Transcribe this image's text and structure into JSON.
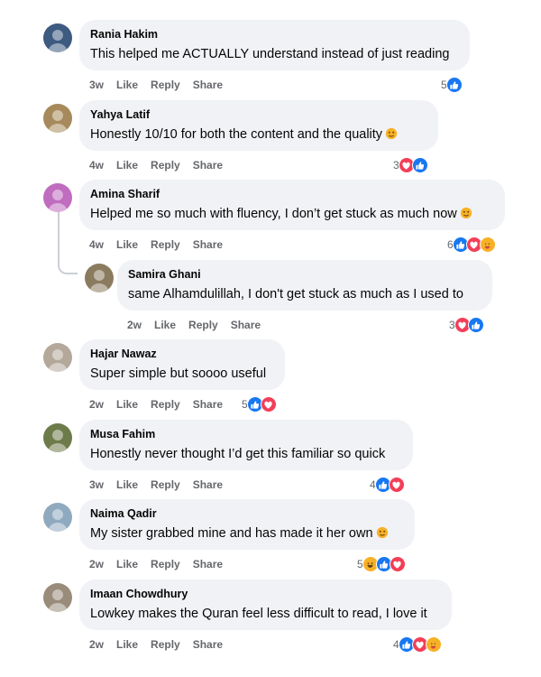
{
  "comments": [
    {
      "name": "Rania Hakim",
      "text": "This helped me ACTUALLY understand instead of just reading",
      "time": "3w",
      "like": "Like",
      "reply": "Reply",
      "share": "Share",
      "count": "5",
      "reactions": [
        "like"
      ],
      "avatar_color": "#3d5a80"
    },
    {
      "name": "Yahya Latif",
      "text": "Honestly 10/10 for both the content and the quality",
      "time": "4w",
      "like": "Like",
      "reply": "Reply",
      "share": "Share",
      "count": "3",
      "reactions": [
        "love",
        "like"
      ],
      "inline_emoji": "raising-hands-emoji",
      "avatar_color": "#a68a5b"
    },
    {
      "name": "Amina Sharif",
      "text": "Helped me so much with fluency, I don’t get stuck as much now",
      "time": "4w",
      "like": "Like",
      "reply": "Reply",
      "share": "Share",
      "count": "6",
      "reactions": [
        "like",
        "love",
        "care"
      ],
      "inline_emoji": "pleading-face-emoji",
      "avatar_color": "#c06cbf"
    },
    {
      "name": "Samira Ghani",
      "text": "same Alhamdulillah,  I don't get stuck as much as I used to",
      "time": "2w",
      "like": "Like",
      "reply": "Reply",
      "share": "Share",
      "count": "3",
      "reactions": [
        "love",
        "like"
      ],
      "avatar_color": "#8b7b5e",
      "is_reply": true
    },
    {
      "name": "Hajar Nawaz",
      "text": "Super simple but soooo useful",
      "time": "2w",
      "like": "Like",
      "reply": "Reply",
      "share": "Share",
      "count": "5",
      "reactions": [
        "like",
        "love"
      ],
      "avatar_color": "#b3a89a"
    },
    {
      "name": "Musa Fahim",
      "text": "Honestly never thought I’d get this familiar so quick",
      "time": "3w",
      "like": "Like",
      "reply": "Reply",
      "share": "Share",
      "count": "4",
      "reactions": [
        "like",
        "love"
      ],
      "avatar_color": "#6d7a4a"
    },
    {
      "name": "Naima Qadir",
      "text": "My sister grabbed mine and has made it her own",
      "time": "2w",
      "like": "Like",
      "reply": "Reply",
      "share": "Share",
      "count": "5",
      "reactions": [
        "haha",
        "like",
        "love"
      ],
      "inline_emoji": "rofl-emoji",
      "avatar_color": "#8fa9bf"
    },
    {
      "name": "Imaan Chowdhury",
      "text": "Lowkey makes the Quran feel less difficult to read, I love it",
      "time": "2w",
      "like": "Like",
      "reply": "Reply",
      "share": "Share",
      "count": "4",
      "reactions": [
        "like",
        "love",
        "care"
      ],
      "avatar_color": "#9a8c7a"
    }
  ],
  "colors": {
    "bubble": "#f0f2f5",
    "secondary_text": "#65676b",
    "like_blue": "#1877f2",
    "love_red": "#f33e58",
    "emoji_yellow": "#f7b125"
  }
}
